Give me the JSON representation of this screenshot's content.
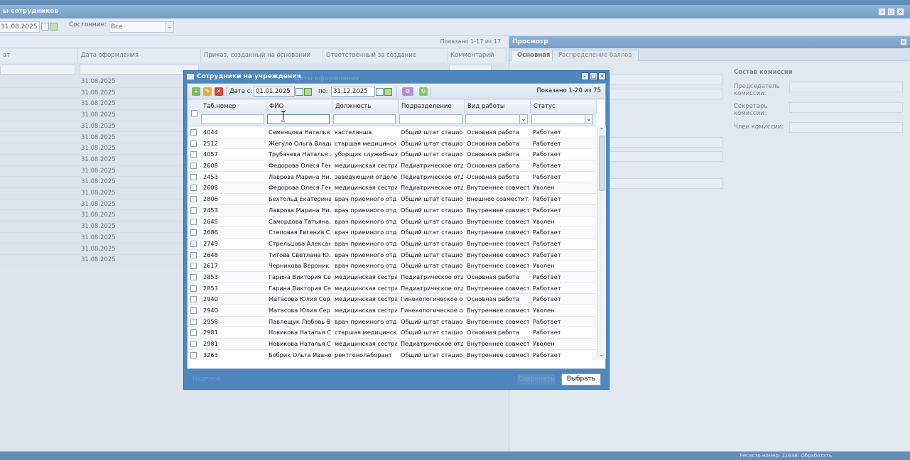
{
  "window": {
    "title": "ы сотрудников"
  },
  "toolbar": {
    "date_value": "31.08.2025",
    "state_label": "Состояние:",
    "state_value": "Все"
  },
  "left_grid": {
    "shown_text": "Показано 1-17 из 17",
    "columns": [
      "ат",
      "Дата оформления",
      "Приказ, созданный на основании",
      "Ответственный за создание",
      "Комментарий"
    ],
    "row_dates": [
      "31.08.2025",
      "31.08.2025",
      "31.08.2025",
      "31.08.2025",
      "31.08.2025",
      "31.08.2025",
      "31.08.2025",
      "31.08.2025",
      "31.08.2025",
      "31.08.2025",
      "31.08.2025",
      "31.08.2025",
      "31.08.2025",
      "31.08.2025",
      "31.08.2025",
      "31.08.2025",
      "31.08.2025"
    ]
  },
  "preview": {
    "title": "Просмотр",
    "tabs": [
      "Основная",
      "Распределение баллов"
    ],
    "commission_title": "Состав комиссии",
    "chairman": "Председатель комиссии:",
    "secretary": "Секретарь комиссии:",
    "member": "Член комиссии:"
  },
  "status_bar": {
    "text": "Регистр номер: 11636: Обработать"
  },
  "modal": {
    "title": "Сотрудники на учреждении",
    "ghost_title": "Даты оформления",
    "date_from_label": "Дата с:",
    "date_from": "01.01.2025",
    "date_to_label": "по:",
    "date_to": "31.12.2025",
    "shown_text": "Показано 1-20 из 75",
    "columns": [
      "Таб.номер",
      "ФИО",
      "Должность",
      "Подразделение",
      "Вид работы",
      "Статус"
    ],
    "fio_filter_value": "",
    "footer_ghost": "Подписи",
    "save_label": "Сохранить",
    "select_label": "Выбрать",
    "rows": [
      {
        "tab": "4044",
        "fio": "Семенцова Наталья ...",
        "pos": "кастелянша",
        "dep": "Общий штат стацио...",
        "work": "Основная работа",
        "status": "Работает"
      },
      {
        "tab": "2512",
        "fio": "Жегуло Ольга Влади...",
        "pos": "старшая медицинск...",
        "dep": "Общий штат стацио...",
        "work": "Основная работа",
        "status": "Работает"
      },
      {
        "tab": "4057",
        "fio": "Трубачева Наталья ...",
        "pos": "уборщик служебных...",
        "dep": "Общий штат стацио...",
        "work": "Основная работа",
        "status": "Работает"
      },
      {
        "tab": "2608",
        "fio": "Федорова Олеся Ген...",
        "pos": "медицинская сестра...",
        "dep": "Педиатрическое отд...",
        "work": "Основная работа",
        "status": "Работает"
      },
      {
        "tab": "2453",
        "fio": "Лаврова Марина Ни...",
        "pos": "заведующий отделе...",
        "dep": "Педиатрическое отд...",
        "work": "Основная работа",
        "status": "Работает"
      },
      {
        "tab": "2608",
        "fio": "Федорова Олеся Ген...",
        "pos": "медицинская сестра...",
        "dep": "Педиатрическое отд...",
        "work": "Внутреннее совмест...",
        "status": "Уволен"
      },
      {
        "tab": "2806",
        "fio": "Бехтольд Екатерина...",
        "pos": "врач приемного отд...",
        "dep": "Общий штат стацио...",
        "work": "Внешнее совместит...",
        "status": "Работает"
      },
      {
        "tab": "2453",
        "fio": "Лаврова Марина Ни...",
        "pos": "врач приемного отд...",
        "dep": "Общий штат стацио...",
        "work": "Внутреннее совмест...",
        "status": "Работает"
      },
      {
        "tab": "2645",
        "fio": "Самордова Татьяна...",
        "pos": "врач приемного отд...",
        "dep": "Общий штат стацио...",
        "work": "Внутреннее совмест...",
        "status": "Уволен"
      },
      {
        "tab": "2686",
        "fio": "Степовая Евгения С...",
        "pos": "врач приемного отд...",
        "dep": "Общий штат стацио...",
        "work": "Внутреннее совмест...",
        "status": "Работает"
      },
      {
        "tab": "2749",
        "fio": "Стрельцова Алексан...",
        "pos": "врач приемного отд...",
        "dep": "Общий штат стацио...",
        "work": "Внутреннее совмест...",
        "status": "Работает"
      },
      {
        "tab": "2648",
        "fio": "Титова Светлана Ю...",
        "pos": "врач приемного отд...",
        "dep": "Общий штат стацио...",
        "work": "Внутреннее совмест...",
        "status": "Работает"
      },
      {
        "tab": "2617",
        "fio": "Черникова Вероник...",
        "pos": "врач приемного отд...",
        "dep": "Общий штат стацио...",
        "work": "Внутреннее совмест...",
        "status": "Уволен"
      },
      {
        "tab": "2853",
        "fio": "Гарина Виктория Се...",
        "pos": "медицинская сестра...",
        "dep": "Педиатрическое отд...",
        "work": "Основная работа",
        "status": "Работает"
      },
      {
        "tab": "2853",
        "fio": "Гарина Виктория Се...",
        "pos": "медицинская сестра...",
        "dep": "Педиатрическое отд...",
        "work": "Внутреннее совмест...",
        "status": "Работает"
      },
      {
        "tab": "2940",
        "fio": "Матасова Юлия Сер...",
        "pos": "медицинская сестра...",
        "dep": "Гинекологическое о...",
        "work": "Основная работа",
        "status": "Работает"
      },
      {
        "tab": "2940",
        "fio": "Матасова Юлия Сер...",
        "pos": "медицинская сестра...",
        "dep": "Гинекологическое о...",
        "work": "Внутреннее совмест...",
        "status": "Уволен"
      },
      {
        "tab": "2958",
        "fio": "Павлещук Любовь В...",
        "pos": "врач приемного отд...",
        "dep": "Общий штат стацио...",
        "work": "Внутреннее совмест...",
        "status": "Работает"
      },
      {
        "tab": "2981",
        "fio": "Новикова Наталья С...",
        "pos": "старшая медицинск...",
        "dep": "Общий штат стацио...",
        "work": "Основная работа",
        "status": "Работает"
      },
      {
        "tab": "2981",
        "fio": "Новикова Наталья С...",
        "pos": "медицинская сестра...",
        "dep": "Педиатрическое отд...",
        "work": "Внутреннее совмест...",
        "status": "Уволен"
      },
      {
        "tab": "3263",
        "fio": "Бобрик Ольга Ивано...",
        "pos": "рентгенолаборант",
        "dep": "Общий штат стацио...",
        "work": "Внутреннее совмест...",
        "status": "Работает"
      }
    ]
  }
}
